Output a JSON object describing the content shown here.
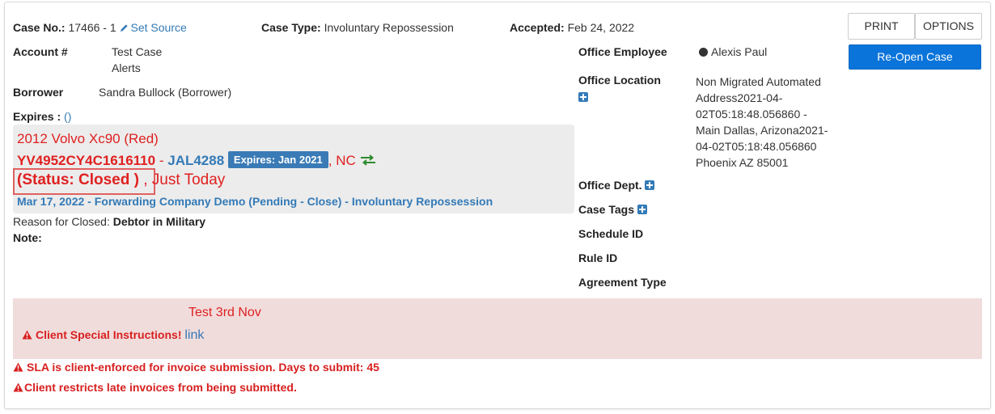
{
  "header": {
    "case_no_label": "Case No.:",
    "case_no_value": "17466 - 1",
    "set_source_label": "Set Source",
    "case_type_label": "Case Type:",
    "case_type_value": "Involuntary Repossession",
    "accepted_label": "Accepted:",
    "accepted_value": "Feb 24, 2022"
  },
  "actions": {
    "print_label": "PRINT",
    "options_label": "OPTIONS",
    "reopen_label": "Re-Open Case"
  },
  "left": {
    "account_label": "Account #",
    "account_line1": "Test Case",
    "account_line2": "Alerts",
    "borrower_label": "Borrower",
    "borrower_value": "Sandra Bullock (Borrower)",
    "expires_label": "Expires :",
    "expires_link": "()"
  },
  "vehicle": {
    "title": "2012 Volvo Xc90 (Red)",
    "vin": "YV4952CY4C1616110",
    "separator": "-",
    "plate": "JAL4288",
    "expires_badge": "Expires: Jan 2021",
    "state": ", NC",
    "status": "(Status: Closed )",
    "status_time": ", Just Today",
    "history_line": "Mar 17, 2022 - Forwarding Company Demo (Pending - Close) - Involuntary Repossession"
  },
  "closed": {
    "reason_label": "Reason for Closed:",
    "reason_value": "Debtor in Military",
    "note_label": "Note:"
  },
  "right": {
    "office_employee_label": "Office Employee",
    "office_employee_value": "Alexis Paul",
    "office_location_label": "Office Location",
    "office_location_lines": [
      "Non Migrated Automated",
      "Address2021-04-",
      "02T05:18:48.056860 -",
      "Main Dallas, Arizona2021-",
      "04-02T05:18:48.056860",
      "Phoenix AZ 85001"
    ],
    "office_dept_label": "Office Dept.",
    "case_tags_label": "Case Tags",
    "schedule_id_label": "Schedule ID",
    "rule_id_label": "Rule ID",
    "agreement_type_label": "Agreement Type"
  },
  "alerts": {
    "note_text": "Test 3rd Nov",
    "special_label": "Client Special Instructions!",
    "special_link": "link",
    "sla_text": "SLA is client-enforced for invoice submission. Days to submit: 45",
    "late_text": "Client restricts late invoices from being submitted."
  },
  "colors": {
    "accent_blue": "#337ab7",
    "primary_button": "#0a74da",
    "alert_red": "#e02020",
    "alert_bg": "#f1dcdc",
    "vehicle_bg": "#ececec",
    "swap_green": "#2e8b2e"
  },
  "icons": [
    "pencil-icon",
    "plus-icon",
    "status-dot-icon",
    "swap-arrows-icon",
    "warning-icon"
  ]
}
